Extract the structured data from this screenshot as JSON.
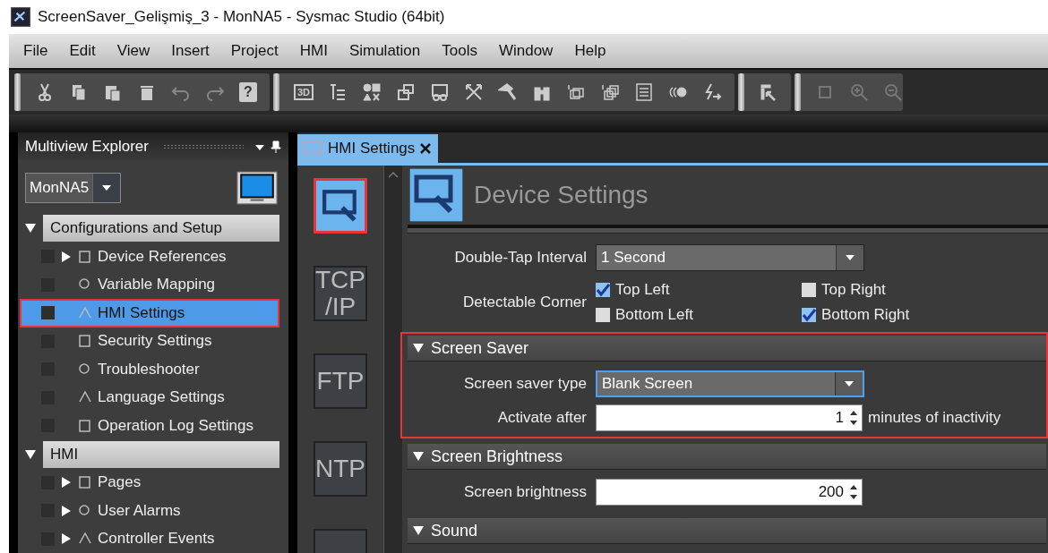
{
  "window": {
    "title": "ScreenSaver_Gelişmiş_3 - MonNA5 - Sysmac Studio (64bit)"
  },
  "menu": [
    "File",
    "Edit",
    "View",
    "Insert",
    "Project",
    "HMI",
    "Simulation",
    "Tools",
    "Window",
    "Help"
  ],
  "toolbar": {
    "label_3d": "3D",
    "help_mark": "?"
  },
  "explorer": {
    "title": "Multiview Explorer",
    "device": "MonNA5",
    "sections": [
      {
        "label": "Configurations and Setup",
        "expanded": true,
        "children": [
          {
            "label": "Device References",
            "expandable": true,
            "selected": false,
            "highlighted": false
          },
          {
            "label": "Variable Mapping",
            "expandable": false,
            "selected": false,
            "highlighted": false
          },
          {
            "label": "HMI Settings",
            "expandable": false,
            "selected": true,
            "highlighted": true
          },
          {
            "label": "Security Settings",
            "expandable": false,
            "selected": false,
            "highlighted": false
          },
          {
            "label": "Troubleshooter",
            "expandable": false,
            "selected": false,
            "highlighted": false
          },
          {
            "label": "Language Settings",
            "expandable": false,
            "selected": false,
            "highlighted": false
          },
          {
            "label": "Operation Log Settings",
            "expandable": false,
            "selected": false,
            "highlighted": false
          }
        ]
      },
      {
        "label": "HMI",
        "expanded": true,
        "children": [
          {
            "label": "Pages",
            "expandable": true,
            "selected": false,
            "highlighted": false
          },
          {
            "label": "User Alarms",
            "expandable": true,
            "selected": false,
            "highlighted": false
          },
          {
            "label": "Controller Events",
            "expandable": true,
            "selected": false,
            "highlighted": false
          }
        ]
      }
    ]
  },
  "editor": {
    "tab": {
      "label": "HMI Settings"
    },
    "categories": [
      {
        "kind": "icon",
        "selected": true,
        "highlighted": true
      },
      {
        "kind": "text",
        "lines": [
          "TCP",
          "/IP"
        ],
        "selected": false,
        "highlighted": false
      },
      {
        "kind": "text",
        "lines": [
          "FTP"
        ],
        "selected": false,
        "highlighted": false
      },
      {
        "kind": "text",
        "lines": [
          "NTP"
        ],
        "selected": false,
        "highlighted": false
      },
      {
        "kind": "blank",
        "selected": false,
        "highlighted": false
      }
    ],
    "page_title": "Device Settings",
    "double_tap": {
      "label": "Double-Tap Interval",
      "value": "1 Second"
    },
    "corner": {
      "label": "Detectable Corner",
      "options": [
        {
          "label": "Top Left",
          "checked": true
        },
        {
          "label": "Top Right",
          "checked": false
        },
        {
          "label": "Bottom Left",
          "checked": false
        },
        {
          "label": "Bottom Right",
          "checked": true
        }
      ]
    },
    "sections": [
      {
        "title": "Screen Saver",
        "expanded": true,
        "highlighted": true,
        "rows": [
          {
            "kind": "dropdown",
            "label": "Screen saver type",
            "value": "Blank Screen",
            "focused": true
          },
          {
            "kind": "spin",
            "label": "Activate after",
            "value": "1",
            "suffix": "minutes of inactivity"
          }
        ]
      },
      {
        "title": "Screen Brightness",
        "expanded": true,
        "highlighted": false,
        "rows": [
          {
            "kind": "spin",
            "label": "Screen brightness",
            "value": "200"
          }
        ]
      },
      {
        "title": "Sound",
        "expanded": true,
        "highlighted": false
      }
    ]
  }
}
